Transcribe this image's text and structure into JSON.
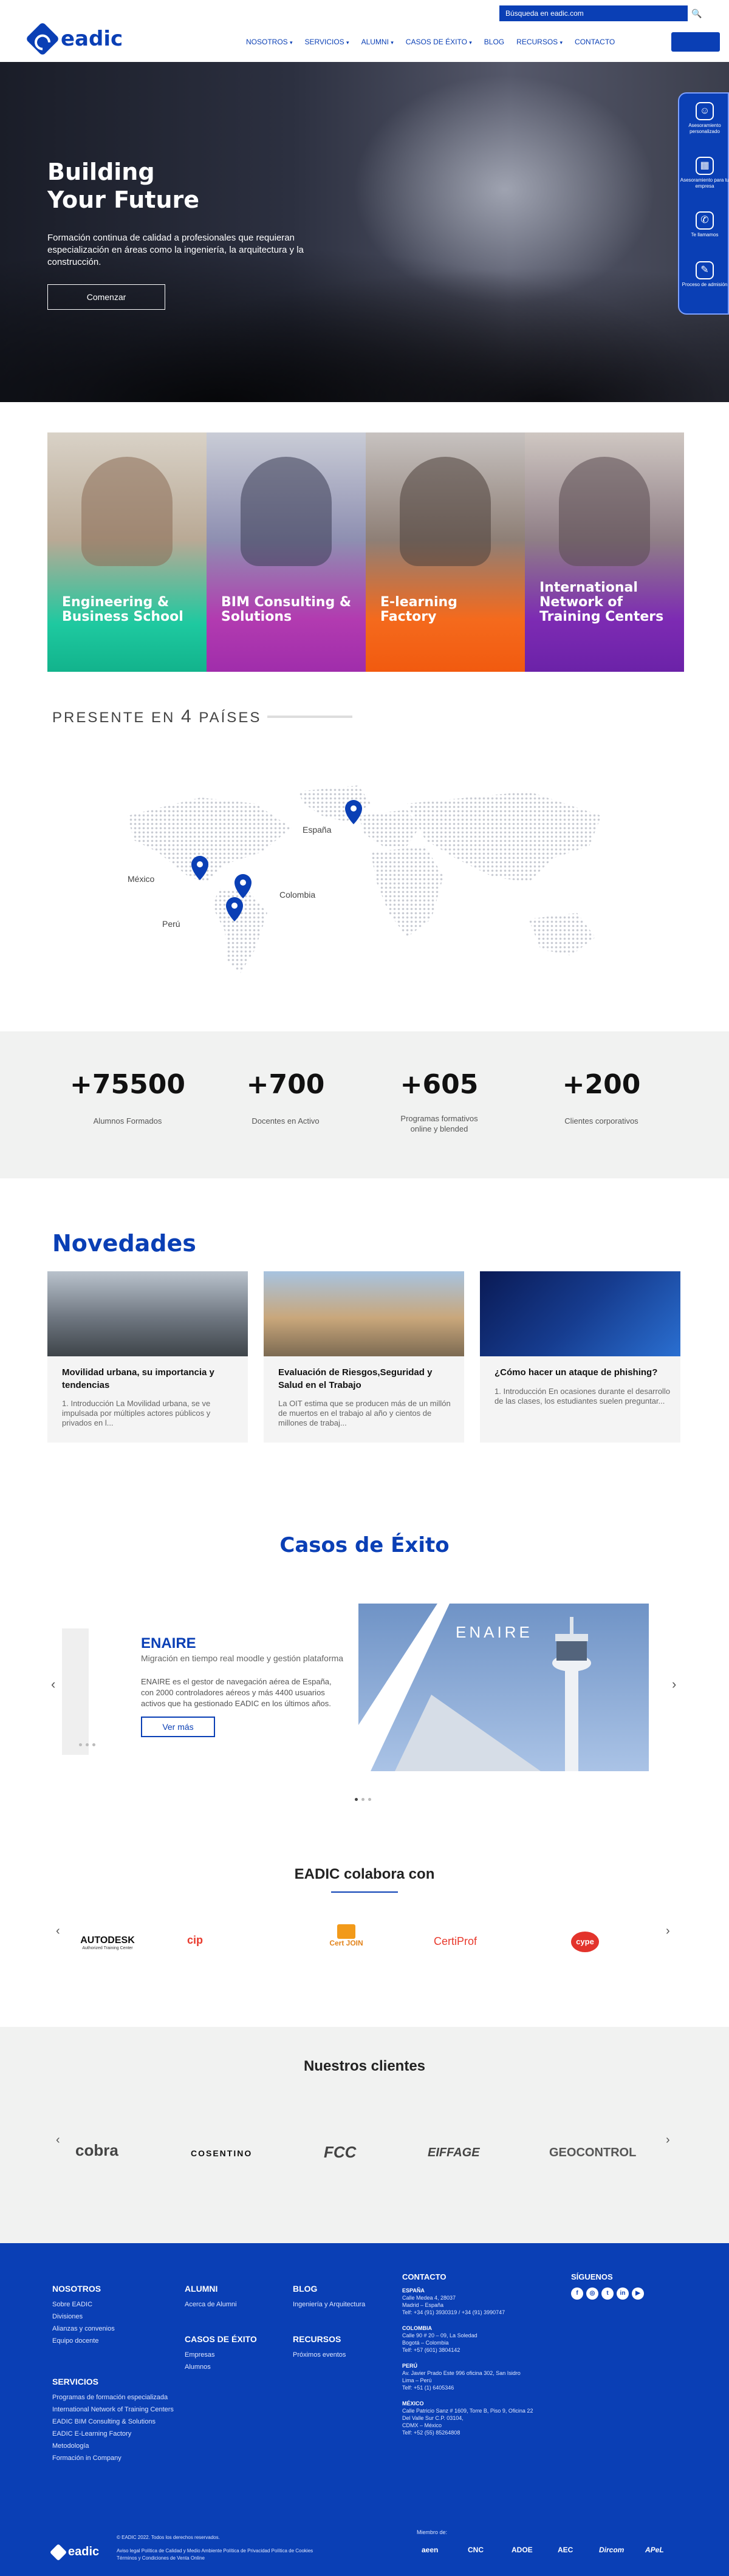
{
  "header": {
    "logo_text": "eadic",
    "search_placeholder": "Búsqueda en eadic.com",
    "search_icon": "🔍",
    "nav": [
      {
        "label": "NOSOTROS",
        "caret": "▾"
      },
      {
        "label": "SERVICIOS",
        "caret": "▾"
      },
      {
        "label": "ALUMNI",
        "caret": "▾"
      },
      {
        "label": "CASOS DE ÉXITO",
        "caret": "▾"
      },
      {
        "label": "BLOG",
        "caret": ""
      },
      {
        "label": "RECURSOS",
        "caret": "▾"
      },
      {
        "label": "CONTACTO",
        "caret": ""
      }
    ]
  },
  "hero": {
    "title_line1": "Building",
    "title_line2": "Your Future",
    "description": "Formación continua de calidad a profesionales que requieran especialización en áreas como la ingeniería, la arquitectura y la construcción.",
    "button": "Comenzar"
  },
  "side_widget": [
    {
      "icon": "☺",
      "label": "Asesoramiento personalizado"
    },
    {
      "icon": "▦",
      "label": "Asesoramiento para tu empresa"
    },
    {
      "icon": "✆",
      "label": "Te llamamos"
    },
    {
      "icon": "✎",
      "label": "Proceso de admisión"
    }
  ],
  "services": [
    {
      "title": "Engineering & Business School"
    },
    {
      "title": "BIM Consulting & Solutions"
    },
    {
      "title": "E-learning Factory"
    },
    {
      "title": "International Network of Training Centers"
    }
  ],
  "presence": {
    "title_pre": "PRESENTE EN",
    "title_num": "4",
    "title_post": "PAÍSES",
    "countries": [
      "España",
      "México",
      "Colombia",
      "Perú"
    ]
  },
  "stats": [
    {
      "value": "+75500",
      "label": "Alumnos Formados"
    },
    {
      "value": "+700",
      "label": "Docentes en Activo"
    },
    {
      "value": "+605",
      "label": "Programas formativos online y blended"
    },
    {
      "value": "+200",
      "label": "Clientes corporativos"
    }
  ],
  "news": {
    "title": "Novedades",
    "items": [
      {
        "title": "Movilidad urbana, su importancia y tendencias",
        "excerpt": "1. Introducción   La Movilidad urbana, se ve impulsada por múltiples actores públicos y privados en l..."
      },
      {
        "title": "Evaluación de Riesgos,Seguridad y Salud en el Trabajo",
        "excerpt": "La OIT estima que se producen más de un millón de muertos en el trabajo al año y cientos de millones de trabaj..."
      },
      {
        "title": "¿Cómo hacer un ataque de phishing?",
        "excerpt": "1. Introducción   En ocasiones durante el desarrollo de las clases, los estudiantes suelen preguntar..."
      }
    ]
  },
  "cases": {
    "title": "Casos de Éxito",
    "name": "ENAIRE",
    "subtitle": "Migración en tiempo real moodle y gestión plataforma",
    "description": "ENAIRE es el gestor de navegación aérea de España, con 2000 controladores aéreos y más 4400 usuarios activos que ha gestionado EADIC en los últimos años.",
    "button": "Ver más",
    "image_text": "ENAIRE",
    "prev": "‹",
    "next": "›"
  },
  "collaborators": {
    "title": "EADIC colabora con",
    "logos": [
      "AUTODESK",
      "cip",
      "Cert JOIN",
      "CertiProf",
      "cype"
    ],
    "autodesk_sub": "Authorized Training Center"
  },
  "clients": {
    "title": "Nuestros clientes",
    "logos": [
      "cobra",
      "COSENTINO",
      "FCC",
      "EIFFAGE",
      "GEOCONTROL"
    ]
  },
  "footer": {
    "col_nosotros": {
      "heading": "NOSOTROS",
      "links": [
        "Sobre EADIC",
        "Divisiones",
        "Alianzas y convenios",
        "Equipo docente"
      ]
    },
    "col_servicios": {
      "heading": "SERVICIOS",
      "links": [
        "Programas de formación especializada",
        "International Network of Training Centers",
        "EADIC BIM Consulting & Solutions",
        "EADIC E-Learning Factory",
        "Metodología",
        "Formación in Company"
      ]
    },
    "col_alumni": {
      "heading": "ALUMNI",
      "links": [
        "Acerca de Alumni"
      ]
    },
    "col_casos": {
      "heading": "CASOS DE ÉXITO",
      "links": [
        "Empresas",
        "Alumnos"
      ]
    },
    "col_blog": {
      "heading": "BLOG",
      "links": [
        "Ingeniería y Arquitectura"
      ]
    },
    "col_recursos": {
      "heading": "RECURSOS",
      "links": [
        "Próximos eventos"
      ]
    },
    "contact": {
      "heading": "CONTACTO",
      "offices": [
        {
          "country": "ESPAÑA",
          "lines": [
            "Calle Medea 4, 28037",
            "Madrid – España",
            "Telf: +34 (91) 3930319 / +34 (91) 3990747"
          ]
        },
        {
          "country": "COLOMBIA",
          "lines": [
            "Calle 90 # 20 – 09, La Soledad",
            "Bogotá – Colombia",
            "Telf: +57 (601) 3804142"
          ]
        },
        {
          "country": "PERÚ",
          "lines": [
            "Av. Javier Prado Este 996 oficina 302, San Isidro",
            "Lima – Perú",
            "Telf: +51 (1) 6405346"
          ]
        },
        {
          "country": "MÉXICO",
          "lines": [
            "Calle Patricio Sanz # 1609, Torre B, Piso 9, Oficina 22",
            "Del Valle Sur C.P. 03104,",
            "CDMX – México",
            "Telf: +52 (55) 85264808"
          ]
        }
      ]
    },
    "social": {
      "heading": "SÍGUENOS",
      "icons": [
        "f",
        "◎",
        "t",
        "in",
        "▶"
      ]
    },
    "bottom": {
      "logo": "eadic",
      "copyright": "© EADIC 2022. Todos los derechos reservados.",
      "legal": "Aviso legal   Política de Calidad y Medio Ambiente   Política de Privacidad   Política de Cookies",
      "terms": "Términos y Condiciones de Venta Online",
      "member_label": "Miembro de:",
      "members": [
        "aeen",
        "CNC",
        "ADOE",
        "AEC",
        "Dircom",
        "APeL"
      ]
    }
  }
}
